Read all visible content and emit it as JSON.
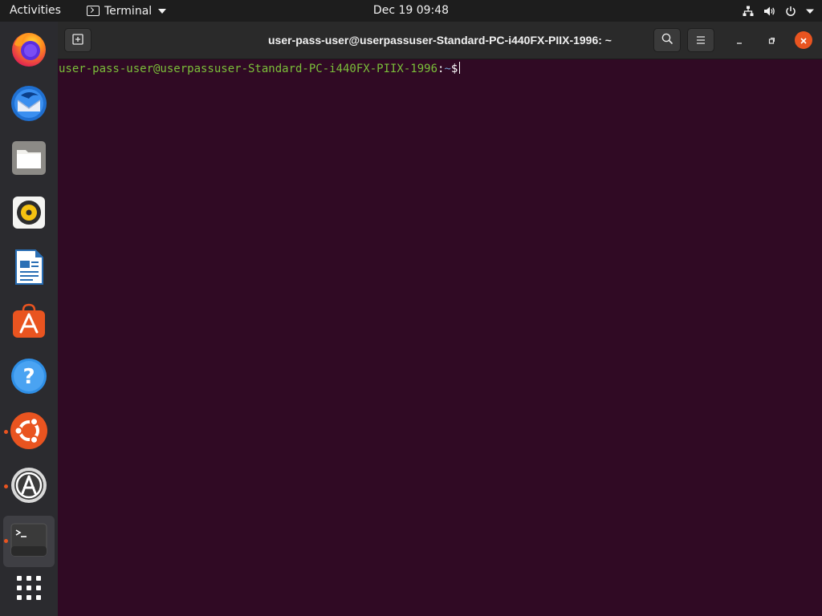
{
  "topbar": {
    "activities_label": "Activities",
    "app_menu_label": "Terminal",
    "clock": "Dec 19  09:48",
    "tray_icons": [
      "network-icon",
      "volume-icon",
      "power-icon",
      "chevron-down-icon"
    ]
  },
  "dock": {
    "items": [
      {
        "name": "firefox-icon",
        "running": false
      },
      {
        "name": "thunderbird-icon",
        "running": false
      },
      {
        "name": "files-icon",
        "running": false
      },
      {
        "name": "rhythmbox-icon",
        "running": false
      },
      {
        "name": "libreoffice-writer-icon",
        "running": false
      },
      {
        "name": "ubuntu-software-icon",
        "running": false
      },
      {
        "name": "help-icon",
        "running": false
      },
      {
        "name": "ubuntu-icon",
        "running": true
      },
      {
        "name": "software-updater-icon",
        "running": true
      },
      {
        "name": "terminal-icon",
        "running": true,
        "active": true
      },
      {
        "name": "show-apps-icon",
        "running": false
      }
    ]
  },
  "window": {
    "title": "user-pass-user@userpassuser-Standard-PC-i440FX-PIIX-1996: ~",
    "buttons": [
      "new-tab-icon",
      "search-icon",
      "hamburger-menu-icon",
      "minimize-icon",
      "maximize-icon",
      "close-icon"
    ]
  },
  "terminal": {
    "prompt_user": "user-pass-user@userpassuser-Standard-PC-i440FX-PIIX-1996",
    "prompt_sep": ":",
    "prompt_path": "~",
    "prompt_symbol": "$",
    "colors": {
      "background": "#300a24",
      "user": "#7bbf3a",
      "path": "#729fcf",
      "accent": "#e95420"
    }
  }
}
